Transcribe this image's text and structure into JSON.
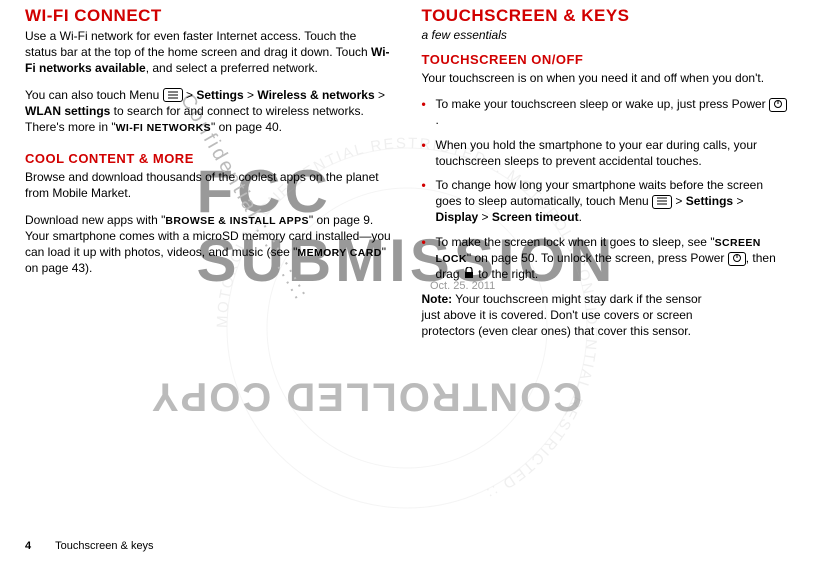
{
  "watermark": {
    "big": "FCC SUBMISSION",
    "copy": "CONTROLLED COPY",
    "ring": "MOTOROLA CONFIDENTIAL RESTRICTED :: MOTOROLA CONFIDENTIAL RESTRICTED ::",
    "diag": "Confidential :::: :::::",
    "date": "Oct. 25. 2011"
  },
  "left": {
    "h1": "WI-FI CONNECT",
    "p1a": "Use a Wi-Fi network for even faster Internet access. Touch the status bar at the top of the home screen and drag it down. Touch ",
    "p1b": "Wi-Fi networks available",
    "p1c": ", and select a preferred network.",
    "p2a": "You can also touch Menu ",
    "p2b": " > ",
    "p2c": "Settings",
    "p2d": " > ",
    "p2e": "Wireless & networks",
    "p2f": " > ",
    "p2g": "WLAN settings",
    "p2h": " to search for and connect to wireless networks. There's more in \"",
    "p2i": "WI-FI NETWORKS",
    "p2j": "\" on page 40.",
    "h2": "COOL CONTENT & MORE",
    "p3": "Browse and download thousands of the coolest apps on the planet from Mobile Market.",
    "p4a": "Download new apps with \"",
    "p4b": "BROWSE & INSTALL APPS",
    "p4c": "\" on page 9. Your smartphone comes with a microSD memory card installed—you can load it up with photos, videos, and music (see \"",
    "p4d": "MEMORY CARD",
    "p4e": "\" on page 43)."
  },
  "right": {
    "h1": "TOUCHSCREEN & KEYS",
    "sub": "a few essentials",
    "h2": "TOUCHSCREEN ON/OFF",
    "intro": "Your touchscreen is on when you need it and off when you don't.",
    "b1a": "To make your touchscreen sleep or wake up, just press Power ",
    "b1b": ".",
    "b2": "When you hold the smartphone to your ear during calls, your touchscreen sleeps to prevent accidental touches.",
    "b3a": "To change how long your smartphone waits before the screen goes to sleep automatically, touch Menu ",
    "b3b": " > ",
    "b3c": "Settings",
    "b3d": " > ",
    "b3e": "Display",
    "b3f": " > ",
    "b3g": "Screen timeout",
    "b3h": ".",
    "b4a": "To make the screen lock when it goes to sleep, see \"",
    "b4b": "SCREEN LOCK",
    "b4c": "\" on page 50. To unlock the screen, press Power ",
    "b4d": ", then drag ",
    "b4e": " to the right.",
    "noteLabel": "Note:",
    "note": " Your touchscreen might stay dark if the sensor just above it is covered. Don't use covers or screen protectors (even clear ones) that cover this sensor."
  },
  "footer": {
    "page": "4",
    "section": "Touchscreen & keys"
  },
  "icons": {
    "menu": "menu-icon",
    "power": "power-icon",
    "lock": "lock-icon"
  }
}
